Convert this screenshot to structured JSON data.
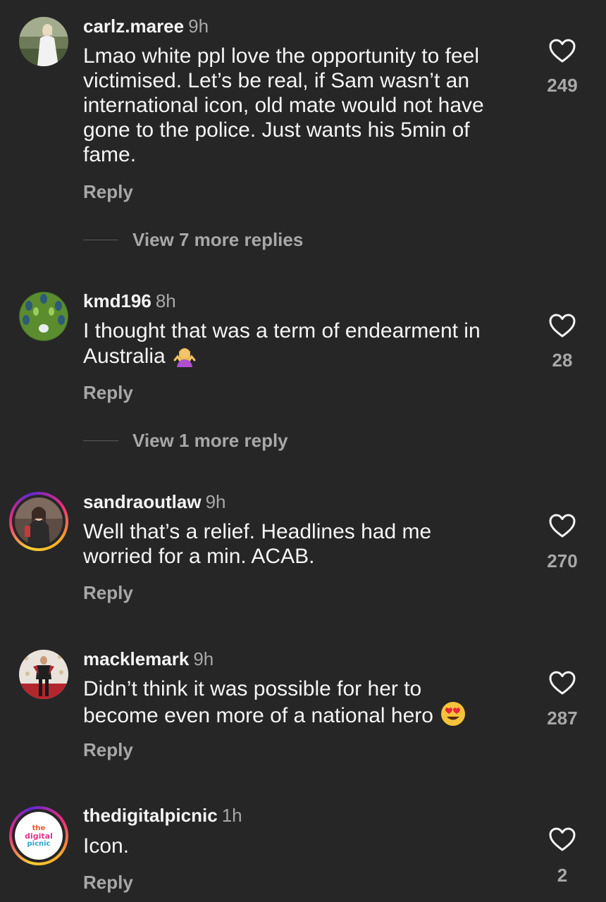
{
  "comments": [
    {
      "username": "carlz.maree",
      "time": "9h",
      "lines": [
        "Lmao white ppl love the opportunity to feel",
        "victimised.  Let’s be real, if Sam wasn’t an",
        "international icon, old mate would not have",
        "gone to the police. Just wants his 5min of",
        "fame."
      ],
      "likes": "249",
      "reply_label": "Reply",
      "view_more": "View 7 more replies",
      "avatar": "person-in-white-dress-photo"
    },
    {
      "username": "kmd196",
      "time": "8h",
      "lines": [
        "I thought that was a term of endearment in",
        "Australia"
      ],
      "emoji": "person-shrugging-emoji",
      "likes": "28",
      "reply_label": "Reply",
      "view_more": "View 1 more reply",
      "avatar": "peacock-feathers-photo"
    },
    {
      "username": "sandraoutlaw",
      "time": "9h",
      "lines": [
        "Well that’s a relief. Headlines had me",
        "worried for a min. ACAB."
      ],
      "likes": "270",
      "reply_label": "Reply",
      "avatar": "woman-portrait-photo"
    },
    {
      "username": "macklemark",
      "time": "9h",
      "lines": [
        "Didn’t think it was possible for her to",
        "become even more of a national hero"
      ],
      "emoji": "heart-eyes-emoji",
      "likes": "287",
      "reply_label": "Reply",
      "avatar": "man-on-red-carpet-photo"
    },
    {
      "username": "thedigitalpicnic",
      "time": "1h",
      "lines": [
        "Icon."
      ],
      "likes": "2",
      "reply_label": "Reply",
      "avatar": "the-digital-picnic-logo",
      "logo_text": [
        "the",
        "digital",
        "picnic"
      ]
    }
  ],
  "colors": {
    "background": "#262626",
    "text": "#f5f5f5",
    "secondary": "#a8a8a8"
  }
}
